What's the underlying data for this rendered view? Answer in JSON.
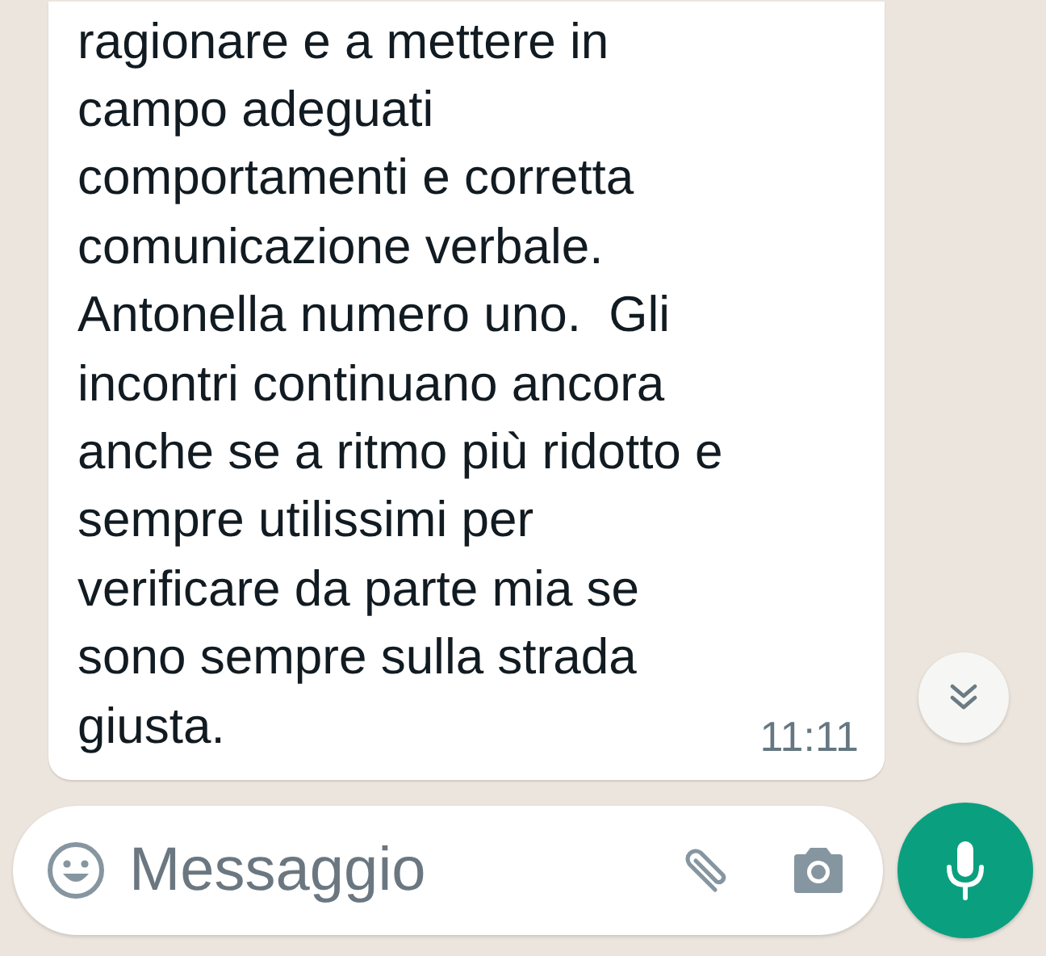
{
  "message": {
    "text": "ragionare e a mettere in\ncampo adeguati\ncomportamenti e corretta\ncomunicazione verbale.\nAntonella numero uno.  Gli\nincontri continuano ancora\nanche se a ritmo più ridotto e\nsempre utilissimi per\nverificare da parte mia se\nsono sempre sulla strada\ngiusta.",
    "time": "11:11"
  },
  "composer": {
    "placeholder": "Messaggio"
  }
}
